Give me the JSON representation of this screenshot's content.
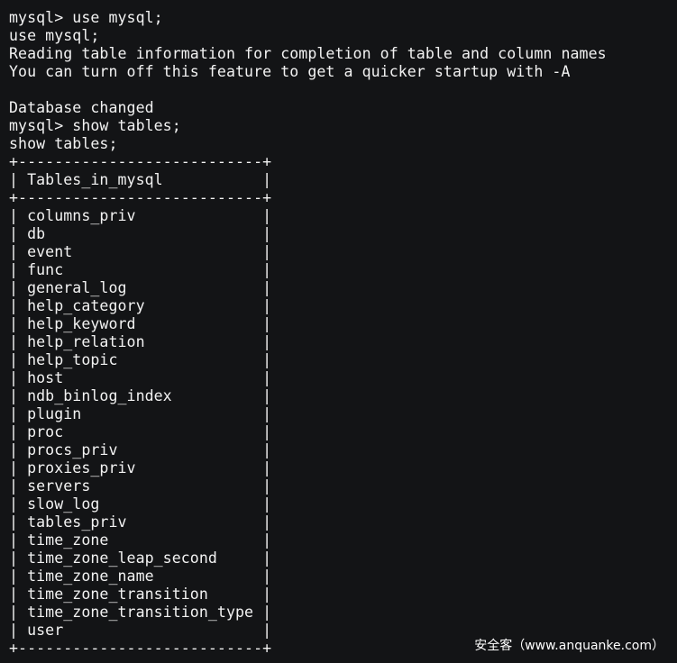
{
  "terminal": {
    "lines": [
      "mysql> use mysql;",
      "use mysql;",
      "Reading table information for completion of table and column names",
      "You can turn off this feature to get a quicker startup with -A",
      "",
      "Database changed",
      "mysql> show tables;",
      "show tables;",
      "+---------------------------+",
      "| Tables_in_mysql           |",
      "+---------------------------+",
      "| columns_priv              |",
      "| db                        |",
      "| event                     |",
      "| func                      |",
      "| general_log               |",
      "| help_category             |",
      "| help_keyword              |",
      "| help_relation             |",
      "| help_topic                |",
      "| host                      |",
      "| ndb_binlog_index          |",
      "| plugin                    |",
      "| proc                      |",
      "| procs_priv                |",
      "| proxies_priv              |",
      "| servers                   |",
      "| slow_log                  |",
      "| tables_priv               |",
      "| time_zone                 |",
      "| time_zone_leap_second     |",
      "| time_zone_name            |",
      "| time_zone_transition      |",
      "| time_zone_transition_type |",
      "| user                      |",
      "+---------------------------+"
    ]
  },
  "watermark": {
    "text": "安全客（www.anquanke.com）"
  },
  "colors": {
    "background": "#131416",
    "foreground": "#f2f2f2"
  }
}
